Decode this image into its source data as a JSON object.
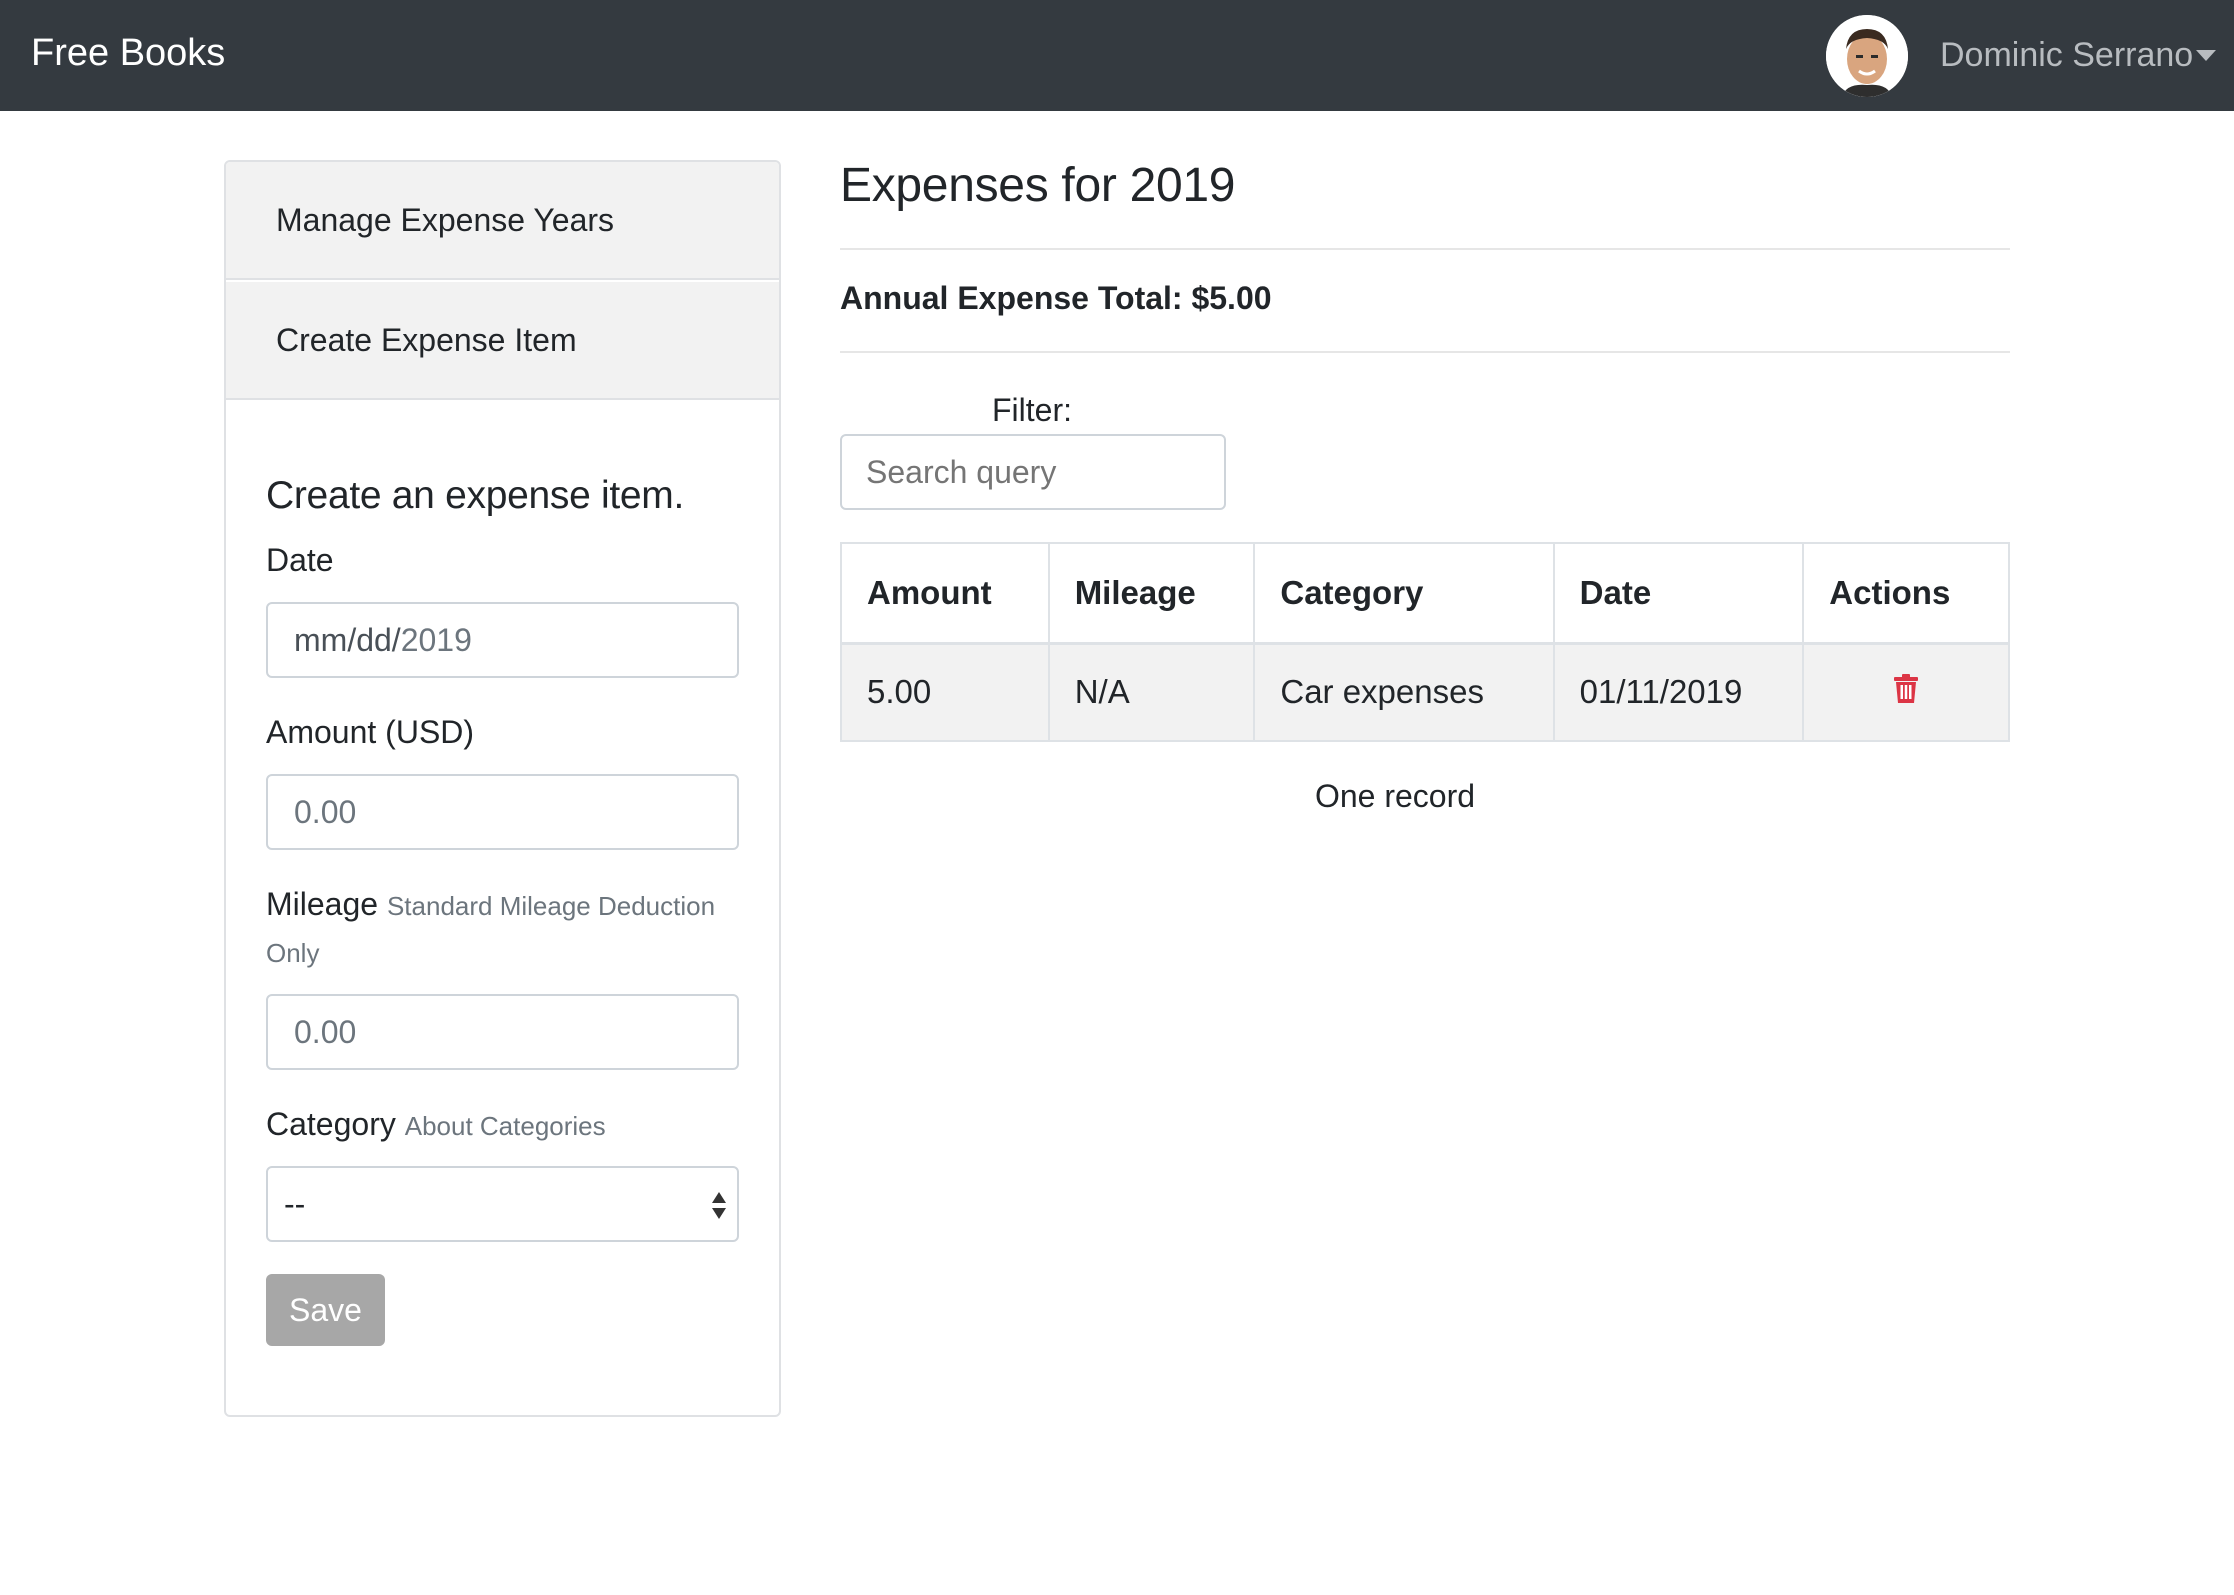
{
  "navbar": {
    "brand": "Free Books",
    "user_name": "Dominic Serrano",
    "avatar_icon": "user-avatar"
  },
  "sidebar": {
    "links": [
      {
        "label": "Manage Expense Years"
      },
      {
        "label": "Create Expense Item"
      }
    ]
  },
  "form": {
    "title": "Create an expense item.",
    "date_label": "Date",
    "date_placeholder_prefix": "mm/dd/",
    "date_year": "2019",
    "amount_label": "Amount (USD)",
    "amount_placeholder": "0.00",
    "mileage_label": "Mileage",
    "mileage_hint_line1": "Standard Mileage Deduction",
    "mileage_hint_line2": "Only",
    "mileage_placeholder": "0.00",
    "category_label": "Category",
    "category_hint": "About Categories",
    "category_selected": "--",
    "save_label": "Save"
  },
  "main": {
    "title": "Expenses for 2019",
    "annual_total": "Annual Expense Total: $5.00",
    "filter_label": "Filter:",
    "search_placeholder": "Search query",
    "table": {
      "headers": [
        "Amount",
        "Mileage",
        "Category",
        "Date",
        "Actions"
      ],
      "rows": [
        {
          "amount": "5.00",
          "mileage": "N/A",
          "category": "Car expenses",
          "date": "01/11/2019",
          "action_icon": "trash-icon"
        }
      ]
    },
    "record_count": "One record"
  },
  "colors": {
    "navbar_bg": "#343a40",
    "danger": "#dc3545",
    "button_disabled": "#a7a7a7"
  }
}
